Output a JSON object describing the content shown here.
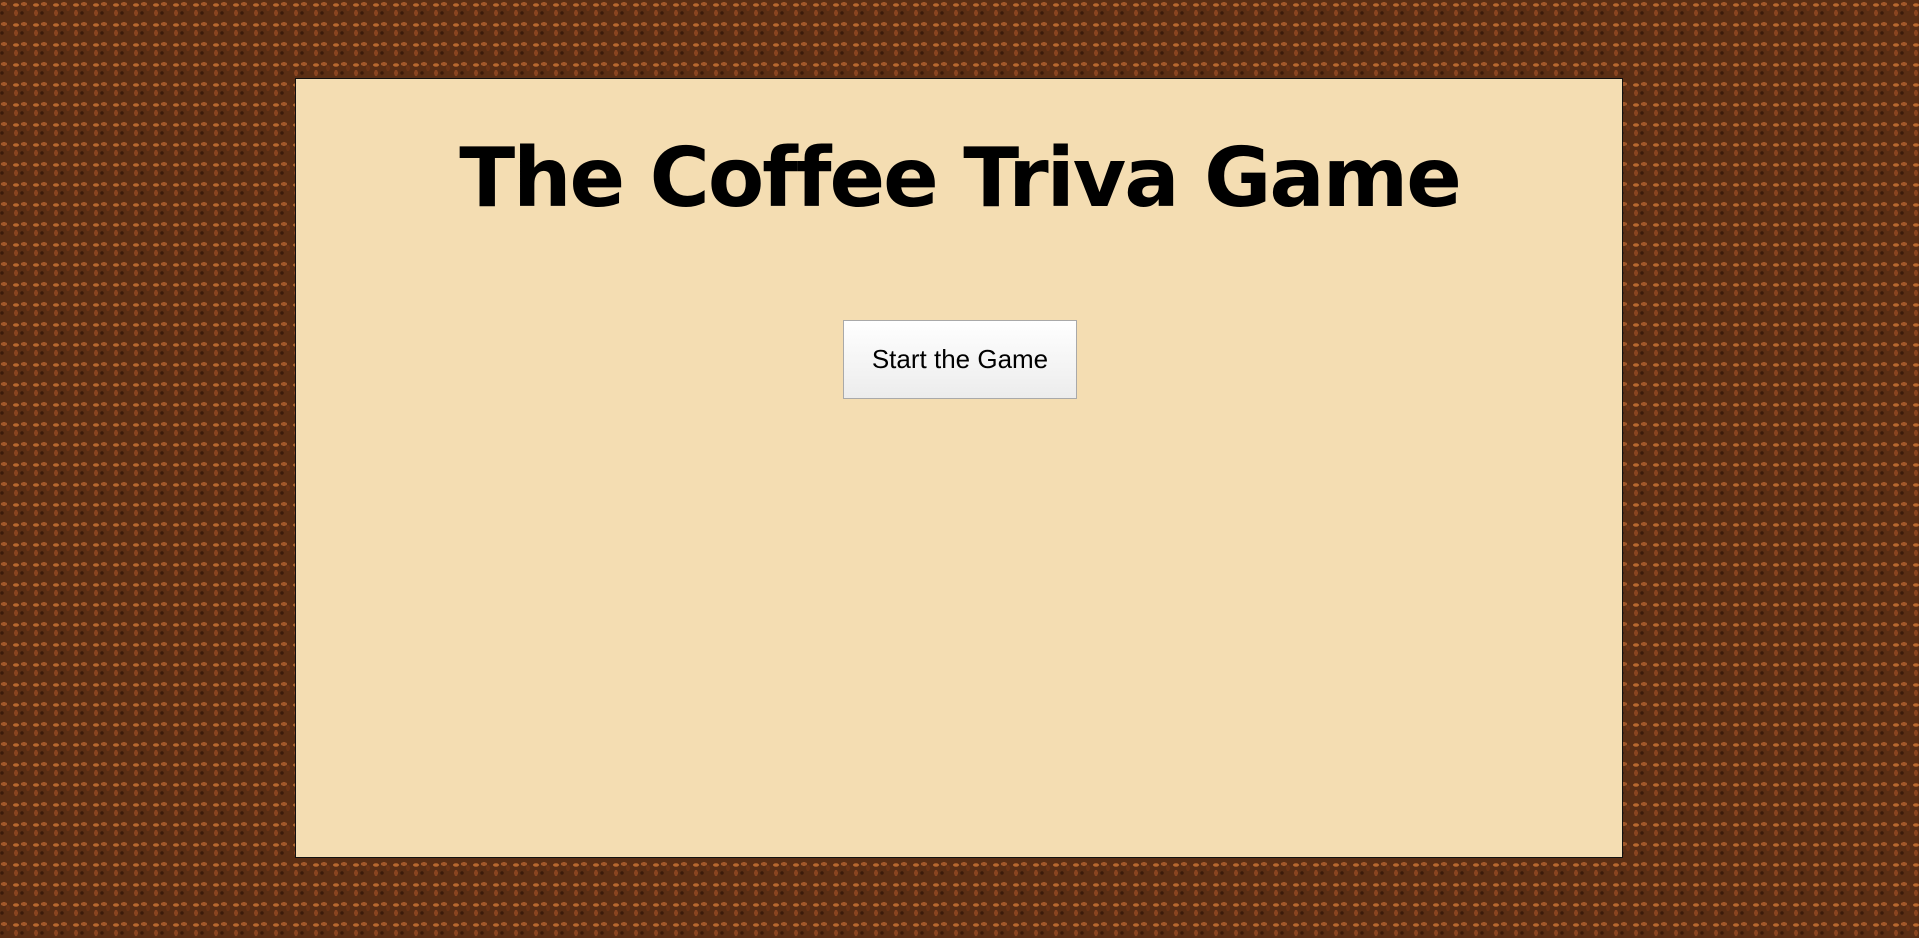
{
  "page": {
    "title": "The Coffee Triva Game",
    "background": "coffee-beans-texture"
  },
  "colors": {
    "panel_background": "#f4ddb2",
    "title_text": "#000000",
    "button_border": "#a9a9a9"
  },
  "start_button": {
    "label": "Start the Game"
  }
}
